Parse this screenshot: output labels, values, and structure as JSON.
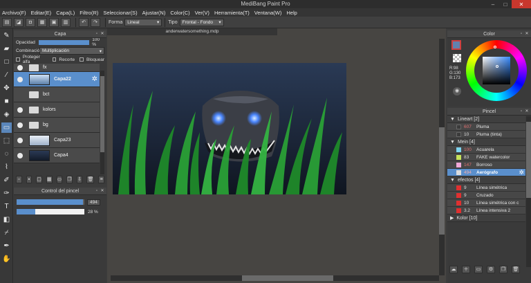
{
  "window": {
    "title": "MediBang Paint Pro",
    "minimize": "–",
    "maximize": "□",
    "close": "✕"
  },
  "menu": [
    "Archivo(F)",
    "Editar(E)",
    "Capa(L)",
    "Filtro(R)",
    "Seleccionar(S)",
    "Ajustar(N)",
    "Color(C)",
    "Ver(V)",
    "Herramienta(T)",
    "Ventana(W)",
    "Help"
  ],
  "toolbar": {
    "undo_icon": "↶",
    "redo_icon": "↷",
    "forma_label": "Forma",
    "forma_value": "Lineal",
    "tipo_label": "Tipo",
    "tipo_value": "Frontal - Fondo"
  },
  "document": {
    "tab_title": "anderwatersomething.mdp"
  },
  "layer_panel": {
    "title": "Capa",
    "opacity_label": "Opacidad",
    "opacity_value": "100 %",
    "opacity_fraction": 1.0,
    "blend_label": "Combinación",
    "blend_value": "Multiplicación",
    "checks": [
      "Proteger alfa",
      "Recorte",
      "Bloquear"
    ],
    "layers": [
      {
        "name": "fx",
        "type": "folder",
        "visible": true,
        "selected": false
      },
      {
        "name": "Capa22",
        "type": "layer",
        "visible": true,
        "selected": true
      },
      {
        "name": "bct",
        "type": "folder",
        "visible": false,
        "selected": false
      },
      {
        "name": "kolors",
        "type": "folder",
        "visible": true,
        "selected": false
      },
      {
        "name": "bg",
        "type": "folder",
        "visible": true,
        "selected": false
      },
      {
        "name": "Capa23",
        "type": "layer",
        "visible": true,
        "selected": false
      },
      {
        "name": "Capa4",
        "type": "layer",
        "visible": true,
        "selected": false
      }
    ]
  },
  "brush_control": {
    "title": "Control del pincel",
    "size_value": "494",
    "size_fraction": 0.98,
    "opacity_value": "28 %",
    "opacity_fraction": 0.28
  },
  "color_panel": {
    "title": "Color",
    "r": "R:98",
    "g": "G:130",
    "b": "B:173",
    "fg_color": "#6282ad"
  },
  "brush_panel": {
    "title": "Pincel",
    "groups": [
      {
        "name": "Lineart [2]",
        "expanded": true,
        "items": [
          {
            "size": "607",
            "name": "Pluma",
            "color": "#3a3a3a",
            "size_color": "#e07070"
          },
          {
            "size": "10",
            "name": "Pluma (tinta)",
            "color": "#3a3a3a",
            "size_color": "#dddddd"
          }
        ]
      },
      {
        "name": "Mein [4]",
        "expanded": true,
        "items": [
          {
            "size": "100",
            "name": "Acuarela",
            "color": "#7fd4f0",
            "size_color": "#e07070"
          },
          {
            "size": "83",
            "name": "FAKE watercolor",
            "color": "#c7e25a",
            "size_color": "#dddddd"
          },
          {
            "size": "147",
            "name": "Borroso",
            "color": "#f0a8d8",
            "size_color": "#e07070"
          },
          {
            "size": "494",
            "name": "Aerógrafo",
            "color": "#dddddd",
            "size_color": "#e07070",
            "selected": true
          }
        ]
      },
      {
        "name": "efectos [4]",
        "expanded": true,
        "items": [
          {
            "size": "9",
            "name": "Línea simétrica",
            "color": "#e03030",
            "size_color": "#dddddd"
          },
          {
            "size": "9",
            "name": "Cruzado",
            "color": "#e03030",
            "size_color": "#dddddd"
          },
          {
            "size": "10",
            "name": "Línea simétrica con c",
            "color": "#e03030",
            "size_color": "#dddddd"
          },
          {
            "size": "3.2",
            "name": "Línea intensiva 2",
            "color": "#e03030",
            "size_color": "#dddddd"
          }
        ]
      },
      {
        "name": "Kolor [10]",
        "expanded": false,
        "items": []
      }
    ]
  },
  "colors": {
    "accent": "#5a8fcc",
    "panel": "#3a3a3a",
    "canvas_bg": "#474542"
  }
}
